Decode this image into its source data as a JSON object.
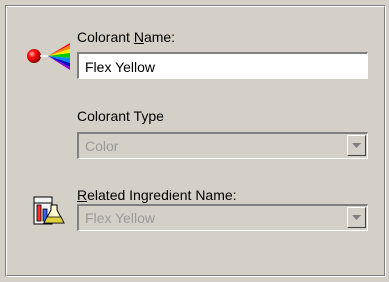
{
  "colorant_name": {
    "label_prefix": "Colorant ",
    "label_mnemonic": "N",
    "label_suffix": "ame:",
    "value": "Flex Yellow"
  },
  "colorant_type": {
    "label": "Colorant Type",
    "selected": "Color"
  },
  "related_ingredient": {
    "label_prefix": "",
    "label_mnemonic": "R",
    "label_suffix": "elated Ingredient Name:",
    "selected": "Flex Yellow"
  },
  "icons": {
    "colorant": "prism-spectrum-icon",
    "ingredient": "lab-flask-icon",
    "dropdown": "chevron-down-icon"
  },
  "colors": {
    "face": "#d4d0c8",
    "disabled_text": "#9a9a9a"
  }
}
